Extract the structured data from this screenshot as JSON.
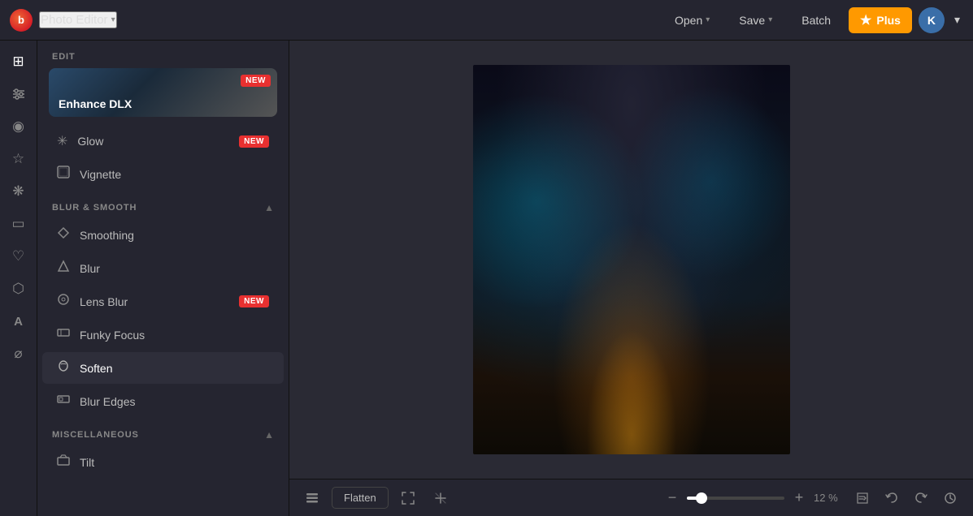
{
  "app": {
    "logo_text": "b",
    "title": "Photo Editor",
    "title_chevron": "▾"
  },
  "topnav": {
    "open_label": "Open",
    "open_chevron": "▾",
    "save_label": "Save",
    "save_chevron": "▾",
    "batch_label": "Batch",
    "plus_label": "Plus",
    "avatar_label": "K",
    "avatar_chevron": "▾"
  },
  "icon_sidebar": {
    "icons": [
      {
        "name": "adjust-icon",
        "glyph": "⊞",
        "title": "Adjust"
      },
      {
        "name": "sliders-icon",
        "glyph": "⚌",
        "title": "Filters"
      },
      {
        "name": "eye-icon",
        "glyph": "◉",
        "title": "Preview"
      },
      {
        "name": "star-icon",
        "glyph": "☆",
        "title": "Favorites"
      },
      {
        "name": "effects-icon",
        "glyph": "❋",
        "title": "Effects"
      },
      {
        "name": "crop-icon",
        "glyph": "▭",
        "title": "Crop"
      },
      {
        "name": "heart-icon",
        "glyph": "♡",
        "title": "Likes"
      },
      {
        "name": "shape-icon",
        "glyph": "⬡",
        "title": "Shapes"
      },
      {
        "name": "text-icon",
        "glyph": "A",
        "title": "Text"
      },
      {
        "name": "brush-icon",
        "glyph": "⌀",
        "title": "Brush"
      }
    ]
  },
  "left_panel": {
    "edit_section": {
      "label": "EDIT",
      "enhance_card": {
        "label": "Enhance DLX",
        "badge": "NEW"
      },
      "items": [
        {
          "icon": "✳",
          "label": "Glow",
          "badge": "NEW"
        },
        {
          "icon": "◎",
          "label": "Vignette",
          "badge": ""
        }
      ]
    },
    "blur_smooth_section": {
      "label": "BLUR & SMOOTH",
      "items": [
        {
          "icon": "◇",
          "label": "Smoothing",
          "badge": "",
          "active": false
        },
        {
          "icon": "△",
          "label": "Blur",
          "badge": "",
          "active": false
        },
        {
          "icon": "◎",
          "label": "Lens Blur",
          "badge": "NEW",
          "active": false
        },
        {
          "icon": "◫",
          "label": "Funky Focus",
          "badge": "",
          "active": false
        },
        {
          "icon": "♧",
          "label": "Soften",
          "badge": "",
          "active": true
        },
        {
          "icon": "◫",
          "label": "Blur Edges",
          "badge": "",
          "active": false
        }
      ]
    },
    "miscellaneous_section": {
      "label": "MISCELLANEOUS",
      "items": [
        {
          "icon": "⊡",
          "label": "Tilt",
          "badge": "",
          "active": false
        }
      ]
    }
  },
  "bottom_toolbar": {
    "flatten_label": "Flatten",
    "zoom_minus": "−",
    "zoom_plus": "+",
    "zoom_value": "12 %",
    "zoom_percent": 12
  },
  "colors": {
    "new_badge_bg": "#e83030",
    "plus_btn_bg": "#f90",
    "active_item_bg": "#2e2e3a"
  }
}
